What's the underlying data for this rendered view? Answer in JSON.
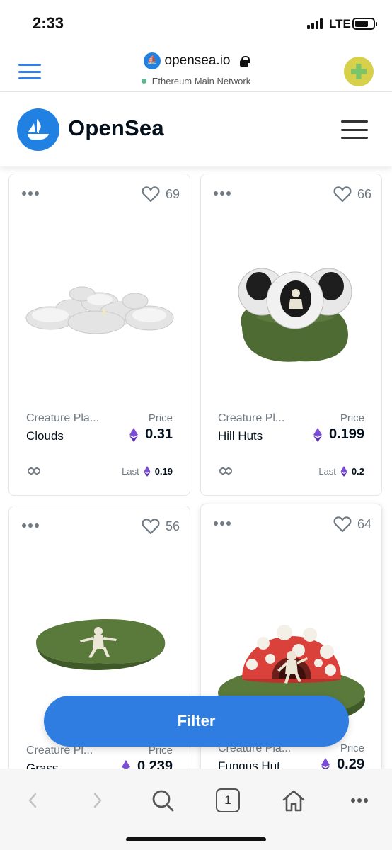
{
  "status_bar": {
    "time": "2:33",
    "network": "LTE",
    "battery_level": 0.76
  },
  "browser": {
    "domain": "opensea.io",
    "network": "Ethereum Main Network"
  },
  "header": {
    "brand": "OpenSea"
  },
  "colors": {
    "accent": "#2081e2",
    "filter_button": "#2f7de1",
    "text_primary": "#04111d",
    "text_secondary": "#707a83",
    "eth_purple": "#6b46c1"
  },
  "cards": [
    {
      "likes": "69",
      "collection": "Creature Pla...",
      "name": "Clouds",
      "price_label": "Price",
      "price": "0.31",
      "last_label": "Last",
      "last_price": "0.19",
      "image": "clouds"
    },
    {
      "likes": "66",
      "collection": "Creature Pl...",
      "name": "Hill Huts",
      "price_label": "Price",
      "price": "0.199",
      "last_label": "Last",
      "last_price": "0.2",
      "image": "hill-huts"
    },
    {
      "likes": "56",
      "collection": "Creature Pl...",
      "name": "Grass",
      "price_label": "Price",
      "price": "0.239",
      "image": "grass"
    },
    {
      "likes": "64",
      "collection": "Creature Pla...",
      "name": "Fungus Hut",
      "price_label": "Price",
      "price": "0.29",
      "image": "fungus-hut"
    }
  ],
  "filter": {
    "label": "Filter"
  },
  "toolbar": {
    "tab_count": "1"
  }
}
